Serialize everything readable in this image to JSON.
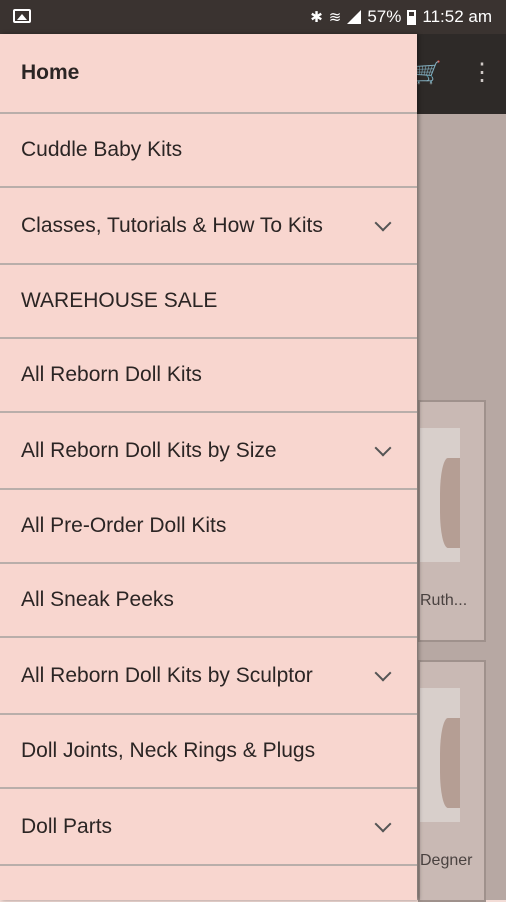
{
  "status_bar": {
    "battery": "57%",
    "time": "11:52 am",
    "icons": [
      "image-icon",
      "bluetooth-icon",
      "wifi-icon",
      "signal-icon",
      "battery-icon"
    ]
  },
  "app": {
    "cards": [
      {
        "label": "Ruth..."
      },
      {
        "label": "Degner"
      }
    ]
  },
  "drawer": {
    "items": [
      {
        "label": "Home",
        "expandable": false
      },
      {
        "label": "Cuddle Baby Kits",
        "expandable": false
      },
      {
        "label": "Classes, Tutorials & How To Kits",
        "expandable": true
      },
      {
        "label": "WAREHOUSE SALE",
        "expandable": false
      },
      {
        "label": "All Reborn Doll Kits",
        "expandable": false
      },
      {
        "label": "All Reborn Doll Kits by Size",
        "expandable": true
      },
      {
        "label": "All Pre-Order Doll Kits",
        "expandable": false
      },
      {
        "label": "All Sneak Peeks",
        "expandable": false
      },
      {
        "label": "All Reborn Doll Kits by Sculptor",
        "expandable": true
      },
      {
        "label": "Doll Joints, Neck Rings & Plugs",
        "expandable": false
      },
      {
        "label": "Doll Parts",
        "expandable": true
      }
    ]
  }
}
